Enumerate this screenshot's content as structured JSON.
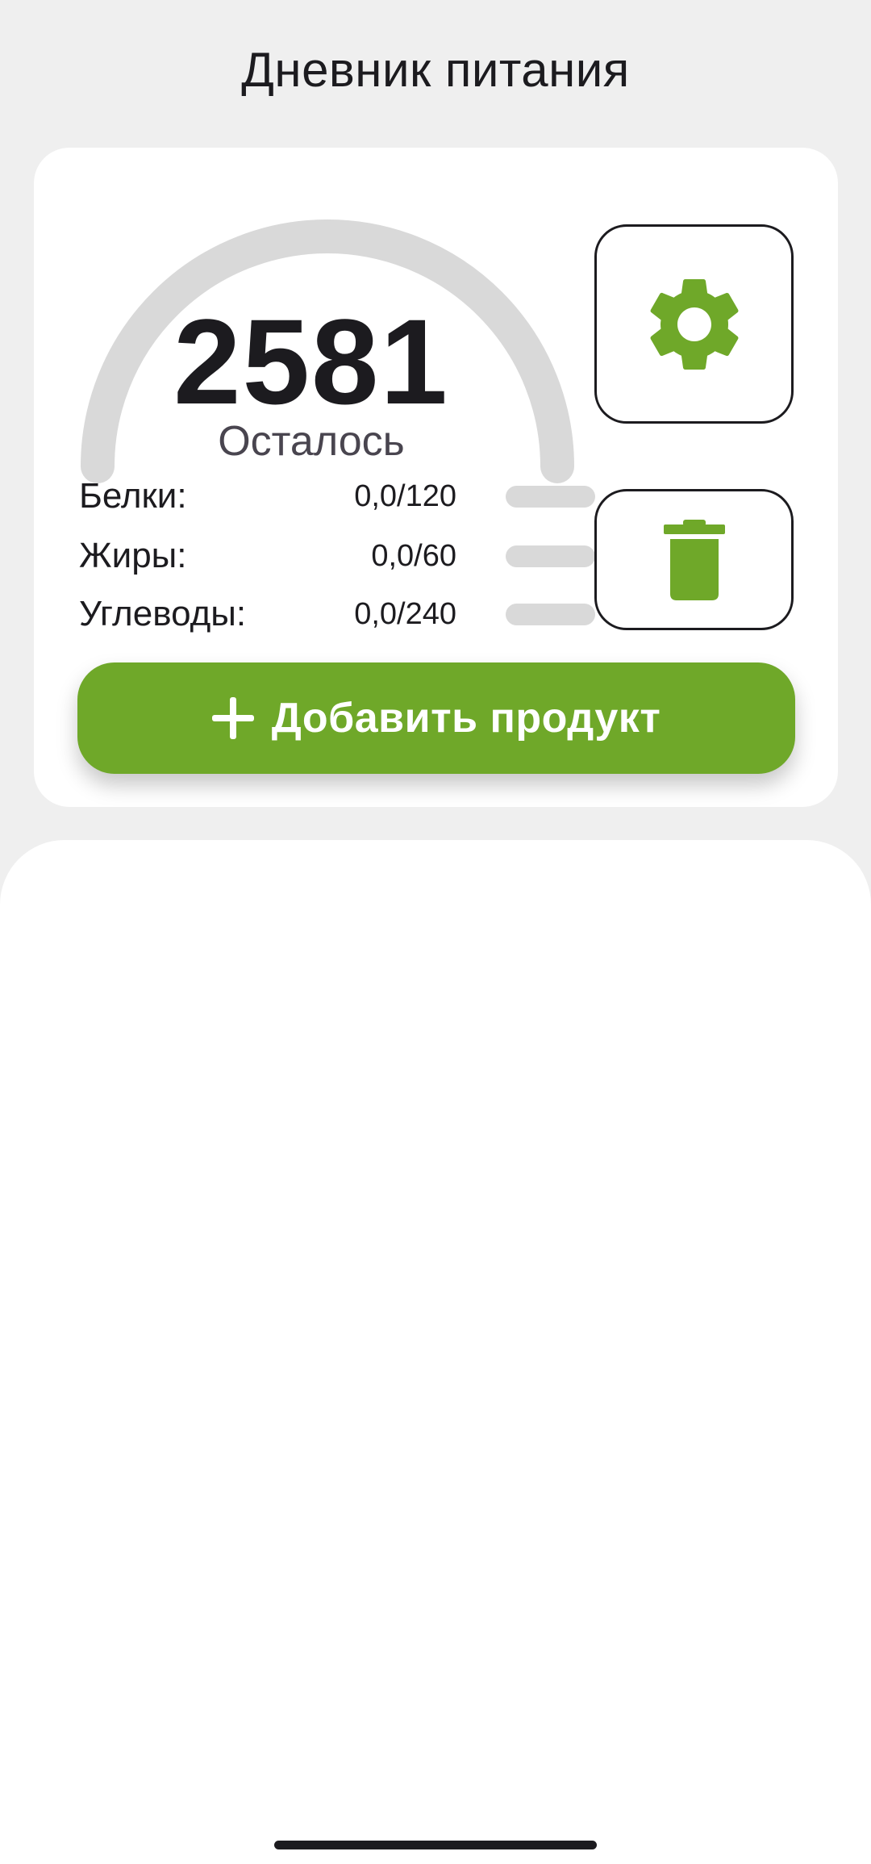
{
  "app": {
    "title": "Дневник питания"
  },
  "summary": {
    "calories_remaining": "2581",
    "calories_label": "Осталось",
    "gauge_progress": 0,
    "macros": [
      {
        "name": "protein",
        "label": "Белки:",
        "value": "0,0/120",
        "progress": 0
      },
      {
        "name": "fat",
        "label": "Жиры:",
        "value": "0,0/60",
        "progress": 0
      },
      {
        "name": "carbs",
        "label": "Углеводы:",
        "value": "0,0/240",
        "progress": 0
      }
    ],
    "settings_button": {
      "icon": "gear-icon"
    },
    "delete_button": {
      "icon": "trash-icon"
    }
  },
  "actions": {
    "add_product_label": "Добавить продукт",
    "add_product_icon": "plus-icon"
  },
  "colors": {
    "accent": "#6fa829",
    "track": "#d9d9d9",
    "background": "#efefef",
    "surface": "#ffffff",
    "text": "#1c1b1f"
  }
}
